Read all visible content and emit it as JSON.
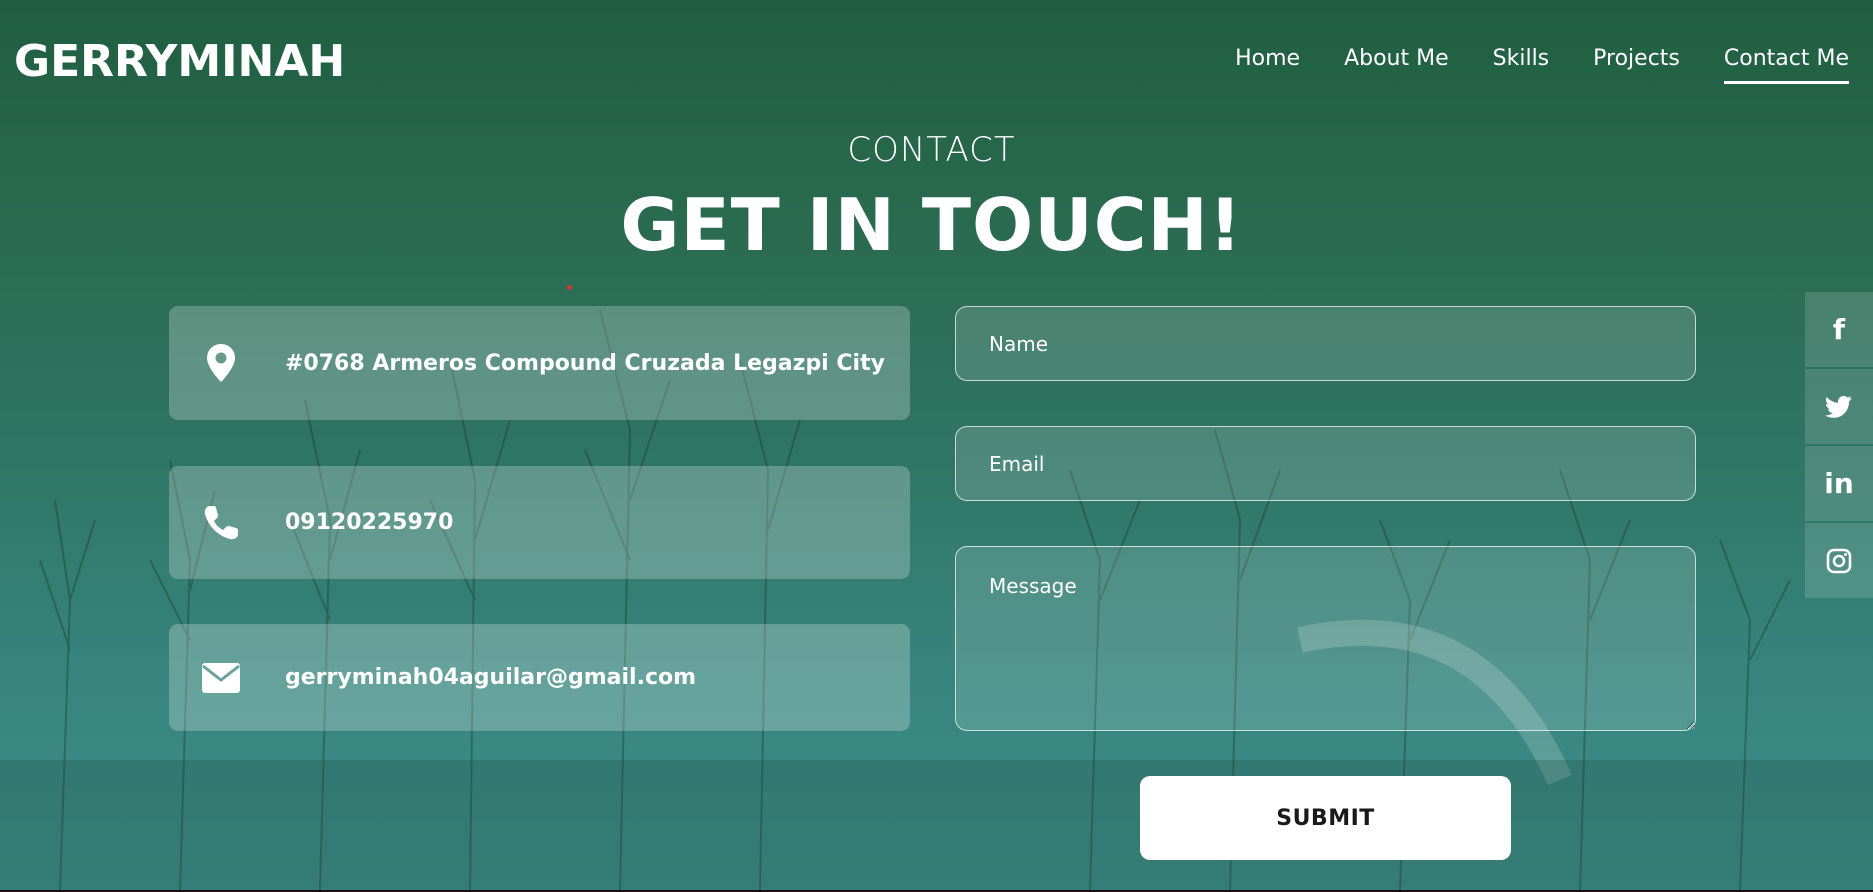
{
  "header": {
    "logo": "GERRYMINAH",
    "nav": [
      {
        "label": "Home"
      },
      {
        "label": "About Me"
      },
      {
        "label": "Skills"
      },
      {
        "label": "Projects"
      },
      {
        "label": "Contact Me",
        "active": true
      }
    ]
  },
  "contact": {
    "eyebrow": "CONTACT",
    "title": "GET IN TOUCH!",
    "info": [
      {
        "icon": "map-pin-icon",
        "text": "#0768 Armeros Compound Cruzada Legazpi City"
      },
      {
        "icon": "phone-icon",
        "text": "09120225970"
      },
      {
        "icon": "envelope-icon",
        "text": "gerryminah04aguilar@gmail.com"
      }
    ]
  },
  "form": {
    "name_placeholder": "Name",
    "email_placeholder": "Email",
    "message_placeholder": "Message",
    "submit_label": "SUBMIT"
  },
  "social": [
    {
      "icon": "facebook-icon",
      "glyph": "f"
    },
    {
      "icon": "twitter-icon",
      "glyph": ""
    },
    {
      "icon": "linkedin-icon",
      "glyph": "in"
    },
    {
      "icon": "instagram-icon",
      "glyph": ""
    }
  ],
  "colors": {
    "background_top": "#1f5e40",
    "background_bottom": "#3d8f8b",
    "text": "#ffffff",
    "button_bg": "#ffffff",
    "button_text": "#1a1a1a"
  }
}
